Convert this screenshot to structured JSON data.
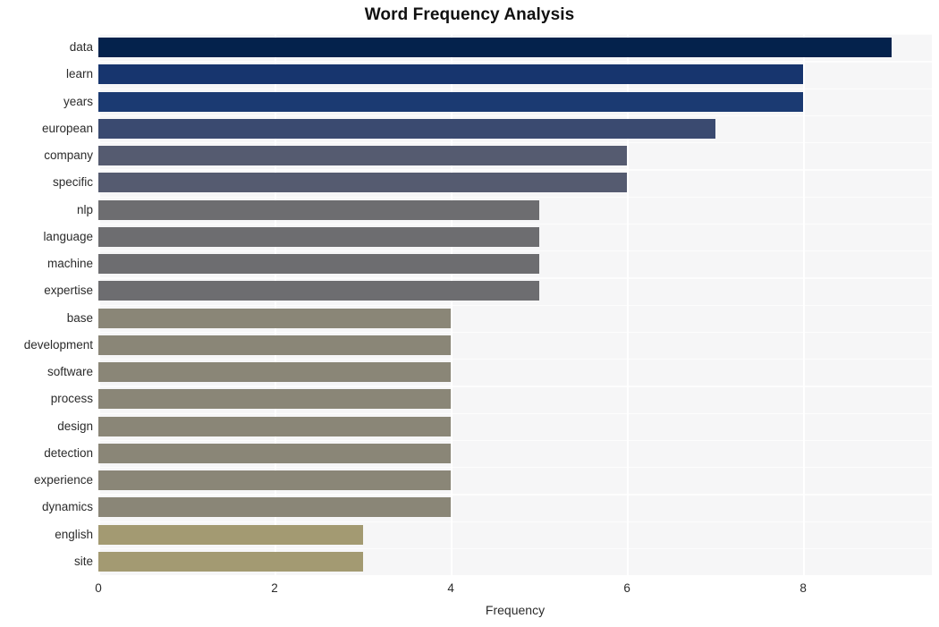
{
  "chart_data": {
    "type": "bar",
    "orientation": "horizontal",
    "title": "Word Frequency Analysis",
    "xlabel": "Frequency",
    "ylabel": "",
    "xlim": [
      0,
      9.46
    ],
    "xticks": [
      0,
      2,
      4,
      6,
      8
    ],
    "xtick_labels": [
      "0",
      "2",
      "4",
      "6",
      "8"
    ],
    "grid": true,
    "legend": "none",
    "categories": [
      "data",
      "learn",
      "years",
      "european",
      "company",
      "specific",
      "nlp",
      "language",
      "machine",
      "expertise",
      "base",
      "development",
      "software",
      "process",
      "design",
      "detection",
      "experience",
      "dynamics",
      "english",
      "site"
    ],
    "values": [
      9,
      8,
      8,
      7,
      6,
      6,
      5,
      5,
      5,
      5,
      4,
      4,
      4,
      4,
      4,
      4,
      4,
      4,
      3,
      3
    ],
    "bar_colors": [
      "#04224c",
      "#17356e",
      "#1b3a72",
      "#3a4a70",
      "#555b70",
      "#555b70",
      "#6d6d70",
      "#6d6d70",
      "#6d6d70",
      "#6d6d70",
      "#8a8677",
      "#8a8677",
      "#8a8677",
      "#8a8677",
      "#8a8677",
      "#8a8677",
      "#8a8677",
      "#8a8677",
      "#a39a72",
      "#a39a72"
    ],
    "plot_background": "#f6f6f7",
    "grid_color": "#ffffff",
    "figure_background": "#ffffff"
  }
}
